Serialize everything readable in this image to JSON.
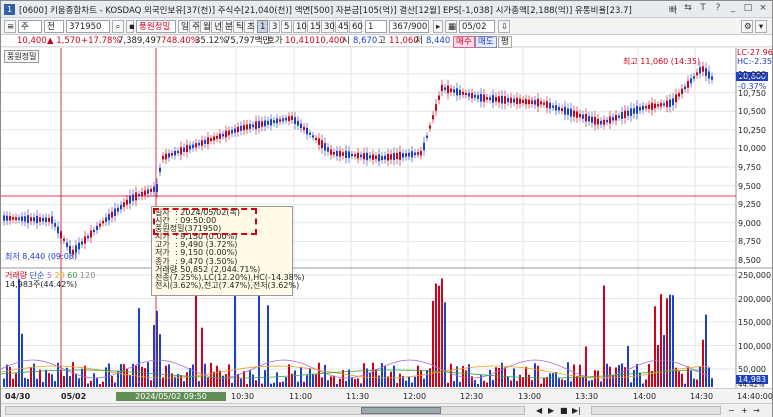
{
  "window": {
    "title": "[0600] 키움종합차트 - KOSDAQ 외국인보유[37(천)] 주식수[21,040(천)] 액면[500] 자본금[105(억)] 결산[12월] EPS[-1,038] 시가총액[2,188(억)] 유통비율[23.7]",
    "icon_text": "1",
    "controls": [
      "빠",
      "⇆",
      "T",
      "?",
      "_",
      "□",
      "×"
    ]
  },
  "toolbar": {
    "market": "주",
    "code_mode": "전",
    "code": "371950",
    "stock_name": "풍원정밀",
    "periods": [
      "일",
      "주",
      "월",
      "년",
      "분",
      "틱",
      "초"
    ],
    "period_selected": "틱",
    "intervals": [
      "1",
      "3",
      "5",
      "10",
      "15",
      "30",
      "45",
      "60"
    ],
    "interval_selected": "1",
    "count_value": "1",
    "range_value": "367/900",
    "date_value": "05/02"
  },
  "info": {
    "price": "10,400",
    "change": "▲ 1,570",
    "change_pct": "+17.78%",
    "volume": "7,389,497",
    "volume_pct": "748.40%",
    "turnover": "35.12%",
    "amount": "75,797백만",
    "quote_label": "호가",
    "ask": "10,410",
    "bid": "10,400",
    "open_label": "시",
    "open": "8,670",
    "high_label": "고",
    "high": "11,060",
    "low_label": "저",
    "low": "8,440",
    "buy_label": "매수",
    "sell_label": "매도",
    "flat_label": "평"
  },
  "chart": {
    "stock_tag": "풍원정밀",
    "high_marker": "최고 11,060 (14:35)",
    "low_marker": "최저 8,440 (09:08)",
    "lc_label": "LC-27.96",
    "hc_label": "HC:-2.35",
    "current_price_tag": "10,800",
    "current_pct_tag": "-0.37%",
    "price_axis": [
      "11,000",
      "10,750",
      "10,500",
      "10,250",
      "10,000",
      "9,750",
      "9,500",
      "9,250",
      "9,000",
      "8,750",
      "8,500"
    ],
    "volume_axis": [
      "250,000",
      "200,000",
      "150,000",
      "100,000",
      "50,000"
    ],
    "volume_current_tag": "14,983",
    "volume_pct_tag": "44.42%",
    "volume_legend": {
      "label": "거래량",
      "unit": "단순",
      "ma": [
        "5",
        "20",
        "60",
        "120"
      ],
      "value": "14,983주(44.42%)"
    },
    "time_axis": [
      "04/30",
      "05/02",
      "10:30",
      "11:00",
      "11:30",
      "12:00",
      "12:30",
      "13:00",
      "13:30",
      "14:00",
      "14:30",
      "14:40:00"
    ],
    "scroll_tag": "2024/05/02 09:50"
  },
  "tooltip": {
    "rows": [
      {
        "k": "일자",
        "v": ": 2024/05/02(목)"
      },
      {
        "k": "시간",
        "v": ": 09:50:00"
      },
      {
        "k": "풍원정밀(371950)",
        "v": ""
      },
      {
        "k": "시가",
        "v": ": 9,150 (0.00%)"
      },
      {
        "k": "고가",
        "v": ": 9,490 (3.72%)"
      },
      {
        "k": "저가",
        "v": ": 9,150 (0.00%)"
      },
      {
        "k": "종가",
        "v": ": 9,470 (3.50%)"
      },
      {
        "k": "거래량",
        "v": ": 50,852 (2,044.71%)"
      },
      {
        "k": "전종(7.25%),LC(12.20%),HC(-14.38%)",
        "v": ""
      },
      {
        "k": "전시(3.62%),전고(7.47%),전저(3.62%)",
        "v": ""
      }
    ]
  },
  "colors": {
    "up": "#d0021b",
    "down": "#1e40c8",
    "grid": "#e6e6e6",
    "crosshair": "#d0021b"
  }
}
